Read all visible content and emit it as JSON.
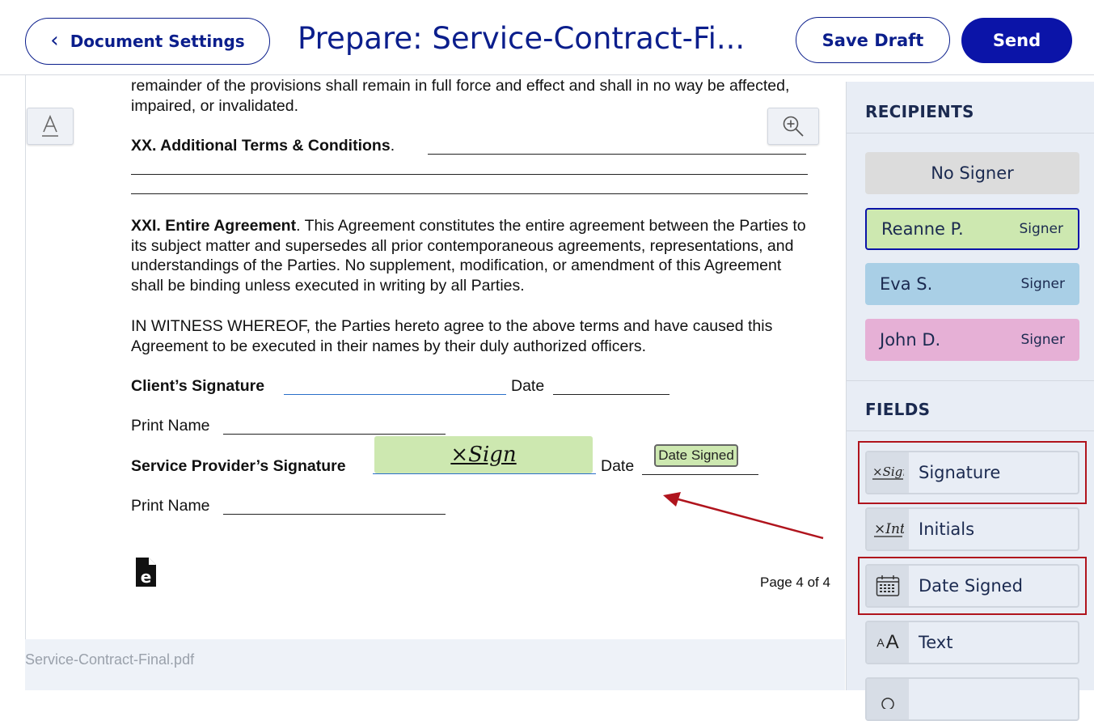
{
  "header": {
    "back_label": "Document Settings",
    "title": "Prepare: Service-Contract-Fi...",
    "save_label": "Save Draft",
    "send_label": "Send"
  },
  "document": {
    "para_top": "remainder of the provisions shall remain in full force and effect and shall in no way be affected, impaired, or invalidated.",
    "sec20_heading": "XX. Additional Terms & Conditions",
    "sec21_heading": "XXI. Entire Agreement",
    "sec21_body": ". This Agreement constitutes the entire agreement between the Parties to its subject matter and supersedes all prior contemporaneous agreements, representations, and understandings of the Parties. No supplement, modification, or amendment of this Agreement shall be binding unless executed in writing by all Parties.",
    "witness": "IN WITNESS WHEREOF, the Parties hereto agree to the above terms and have caused this Agreement to be executed in their names by their duly authorized officers.",
    "client_sig_label": "Client’s Signature",
    "date_label": "Date",
    "print_name_label": "Print Name",
    "provider_sig_label": "Service Provider’s Signature",
    "sig_field_text": "×Sign",
    "date_signed_tag": "Date Signed",
    "page_indicator": "Page 4 of 4",
    "filename": "Service-Contract-Final.pdf"
  },
  "sidebar": {
    "recipients_title": "RECIPIENTS",
    "recipients": [
      {
        "name": "No Signer",
        "role": "",
        "color": "#dcdcdc"
      },
      {
        "name": "Reanne P.",
        "role": "Signer",
        "color": "#cde8b0",
        "border": "#0b14a8"
      },
      {
        "name": "Eva S.",
        "role": "Signer",
        "color": "#a9cfe6"
      },
      {
        "name": "John D.",
        "role": "Signer",
        "color": "#e6b0d6"
      }
    ],
    "fields_title": "FIELDS",
    "fields": [
      {
        "label": "Signature",
        "icon": "signature-icon"
      },
      {
        "label": "Initials",
        "icon": "initials-icon"
      },
      {
        "label": "Date Signed",
        "icon": "calendar-icon"
      },
      {
        "label": "Text",
        "icon": "text-size-icon"
      }
    ]
  },
  "colors": {
    "brand": "#0b14a8",
    "highlight": "#b0141d",
    "signer_green": "#cde8b0"
  }
}
